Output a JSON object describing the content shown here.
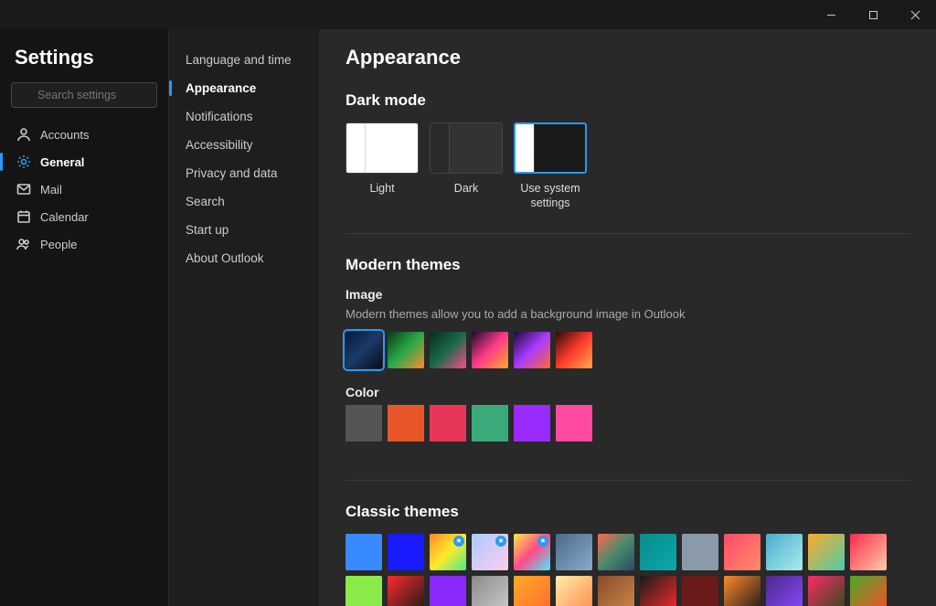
{
  "window": {
    "title": "Settings"
  },
  "search": {
    "placeholder": "Search settings"
  },
  "nav1": {
    "items": [
      {
        "label": "Accounts",
        "icon": "person"
      },
      {
        "label": "General",
        "icon": "gear",
        "active": true
      },
      {
        "label": "Mail",
        "icon": "mail"
      },
      {
        "label": "Calendar",
        "icon": "calendar"
      },
      {
        "label": "People",
        "icon": "people"
      }
    ]
  },
  "nav2": {
    "items": [
      {
        "label": "Language and time"
      },
      {
        "label": "Appearance",
        "active": true
      },
      {
        "label": "Notifications"
      },
      {
        "label": "Accessibility"
      },
      {
        "label": "Privacy and data"
      },
      {
        "label": "Search"
      },
      {
        "label": "Start up"
      },
      {
        "label": "About Outlook"
      }
    ]
  },
  "page": {
    "heading": "Appearance",
    "dark_mode": {
      "heading": "Dark mode",
      "options": [
        {
          "label": "Light",
          "left": "#ffffff",
          "right": "#ffffff"
        },
        {
          "label": "Dark",
          "left": "#2a2a2a",
          "right": "#333"
        },
        {
          "label": "Use system settings",
          "left": "#ffffff",
          "right": "#1a1a1a",
          "selected": true
        }
      ]
    },
    "modern_themes": {
      "heading": "Modern themes",
      "image_label": "Image",
      "image_desc": "Modern themes allow you to add a background image in Outlook",
      "images": [
        {
          "name": "wave-dark",
          "g": [
            "#0a1a3a",
            "#1a3a6a",
            "#0a0a1a"
          ],
          "selected": true
        },
        {
          "name": "ribbon-green",
          "g": [
            "#0a3a1a",
            "#2aaa4a",
            "#ff8a2a"
          ]
        },
        {
          "name": "aurora",
          "g": [
            "#0a2a1a",
            "#1a6a4a",
            "#ff4a8a"
          ]
        },
        {
          "name": "swirl",
          "g": [
            "#1a0a2a",
            "#ff3a8a",
            "#ffaa2a"
          ]
        },
        {
          "name": "planets",
          "g": [
            "#1a0a3a",
            "#aa3aff",
            "#ff6a2a"
          ]
        },
        {
          "name": "abstract-red",
          "g": [
            "#2a0a0a",
            "#ff3a2a",
            "#ffaa4a"
          ]
        }
      ],
      "color_label": "Color",
      "colors": [
        "#555555",
        "#e8562a",
        "#e8355a",
        "#3aaa7a",
        "#9a2aff",
        "#ff4aa0"
      ]
    },
    "classic_themes": {
      "heading": "Classic themes",
      "swatches": [
        {
          "c": "#3a8aff"
        },
        {
          "c": "#1a1aff"
        },
        {
          "g": [
            "#ff8a2a",
            "#ffea2a",
            "#4aea8a"
          ],
          "badge": true
        },
        {
          "g": [
            "#aaccff",
            "#ffccee"
          ],
          "badge": true
        },
        {
          "g": [
            "#ffea4a",
            "#ff4a8a",
            "#4aeaff"
          ],
          "badge": true
        },
        {
          "g": [
            "#4a6a8a",
            "#8aaacc"
          ]
        },
        {
          "g": [
            "#ff6a4a",
            "#4a8a6a",
            "#2a4a6a"
          ]
        },
        {
          "g": [
            "#0a8a8a",
            "#0aaaaa"
          ]
        },
        {
          "c": "#8a9aaa"
        },
        {
          "g": [
            "#ff4a6a",
            "#ff8a6a"
          ]
        },
        {
          "g": [
            "#4aaacc",
            "#aaeeee"
          ]
        },
        {
          "g": [
            "#ffaa2a",
            "#4accaa"
          ]
        },
        {
          "g": [
            "#ff2a4a",
            "#ffccaa"
          ]
        },
        {
          "c": "#8aea4a"
        },
        {
          "g": [
            "#ff2a2a",
            "#1a1a1a"
          ]
        },
        {
          "c": "#8a2aff"
        },
        {
          "g": [
            "#8a8a8a",
            "#cccccc"
          ]
        },
        {
          "g": [
            "#ffaa2a",
            "#ff6a2a"
          ]
        },
        {
          "g": [
            "#ffeeaa",
            "#ff8a4a"
          ]
        },
        {
          "g": [
            "#8a4a2a",
            "#cc8a4a"
          ]
        },
        {
          "g": [
            "#1a1a1a",
            "#ff2a2a"
          ]
        },
        {
          "c": "#6a1a1a"
        },
        {
          "g": [
            "#ff8a2a",
            "#1a1a1a"
          ]
        },
        {
          "g": [
            "#4a2a8a",
            "#8a4aff"
          ]
        },
        {
          "g": [
            "#ff2a6a",
            "#2a4a1a"
          ]
        },
        {
          "g": [
            "#4aaa2a",
            "#ff4a2a"
          ]
        }
      ]
    }
  }
}
